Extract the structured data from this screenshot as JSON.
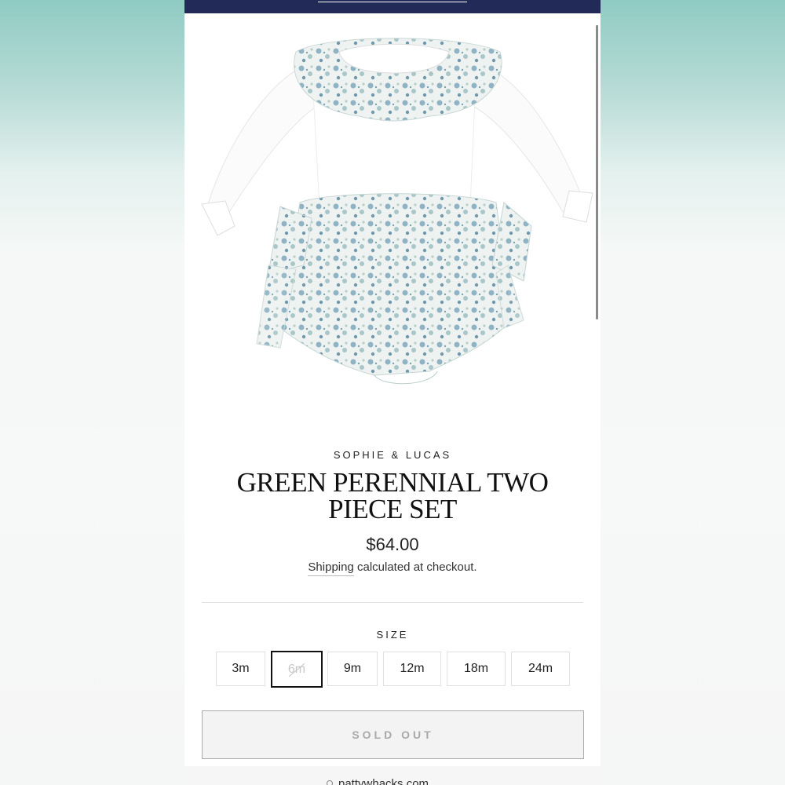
{
  "product": {
    "vendor": "SOPHIE & LUCAS",
    "title": "GREEN PERENNIAL TWO PIECE SET",
    "price": "$64.00",
    "shipping_link": "Shipping",
    "shipping_rest": " calculated at checkout."
  },
  "size": {
    "label": "SIZE",
    "options": [
      {
        "label": "3m",
        "state": "available"
      },
      {
        "label": "6m",
        "state": "selected-unavailable"
      },
      {
        "label": "9m",
        "state": "available"
      },
      {
        "label": "12m",
        "state": "available"
      },
      {
        "label": "18m",
        "state": "available"
      },
      {
        "label": "24m",
        "state": "available"
      }
    ]
  },
  "buy_button": {
    "label": "SOLD OUT",
    "state": "disabled"
  },
  "footer": {
    "url": "pattywhacks.com",
    "icon": "map-pin-icon"
  },
  "colors": {
    "announcement_bar": "#222a58",
    "floral_print": "#8fb3c4",
    "background_teal": "#8fcbc3"
  }
}
